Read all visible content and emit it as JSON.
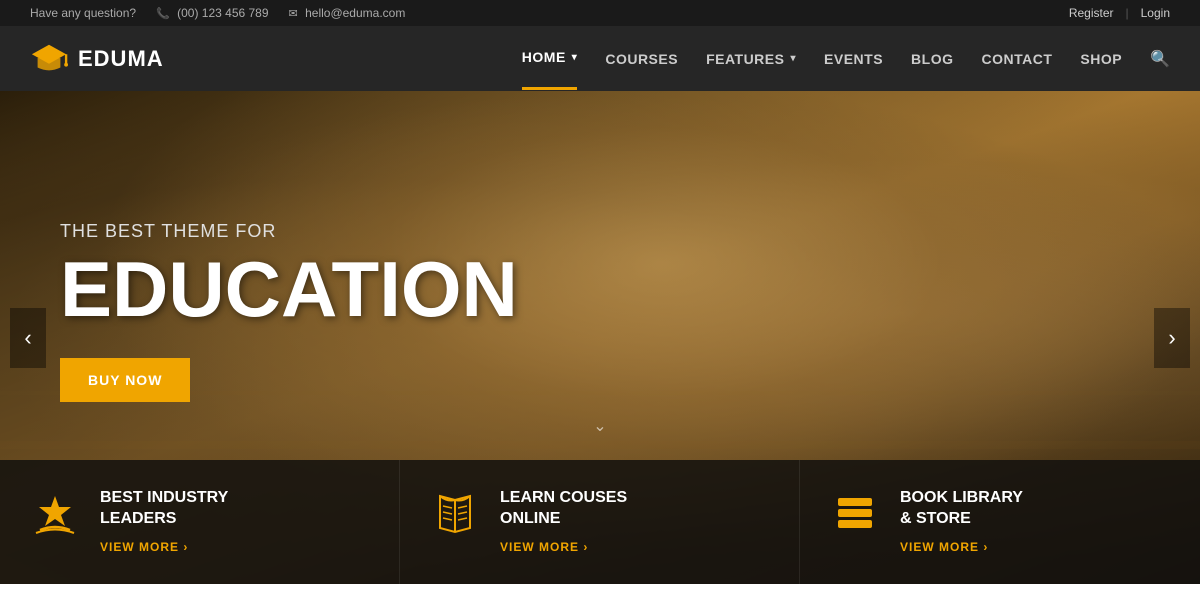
{
  "topbar": {
    "question_label": "Have any question?",
    "phone": "(00) 123 456 789",
    "email": "hello@eduma.com",
    "register": "Register",
    "login": "Login"
  },
  "header": {
    "logo_text": "EDUMA",
    "nav": [
      {
        "label": "HOME",
        "active": true,
        "has_chevron": true
      },
      {
        "label": "COURSES",
        "active": false,
        "has_chevron": false
      },
      {
        "label": "FEATURES",
        "active": false,
        "has_chevron": true
      },
      {
        "label": "EVENTS",
        "active": false,
        "has_chevron": false
      },
      {
        "label": "BLOG",
        "active": false,
        "has_chevron": false
      },
      {
        "label": "CONTACT",
        "active": false,
        "has_chevron": false
      },
      {
        "label": "SHOP",
        "active": false,
        "has_chevron": false
      }
    ]
  },
  "hero": {
    "subtitle": "THE BEST THEME FOR",
    "title": "EDUCATION",
    "buy_btn": "BUY NOW",
    "arrow_left": "‹",
    "arrow_right": "›",
    "scroll_arrow": "⌄"
  },
  "features": [
    {
      "id": "industry-leaders",
      "icon": "⭐",
      "title": "BEST INDUSTRY\nLEADERS",
      "link": "VIEW MORE"
    },
    {
      "id": "learn-online",
      "icon": "📖",
      "title": "LEARN COUSES\nONLINE",
      "link": "VIEW MORE"
    },
    {
      "id": "book-library",
      "icon": "📚",
      "title": "BOOK LIBRARY\n& STORE",
      "link": "VIEW MORE"
    }
  ],
  "colors": {
    "accent": "#f0a500",
    "dark_bg": "#1a1a1a",
    "header_bg": "rgba(20,20,20,0.92)"
  }
}
